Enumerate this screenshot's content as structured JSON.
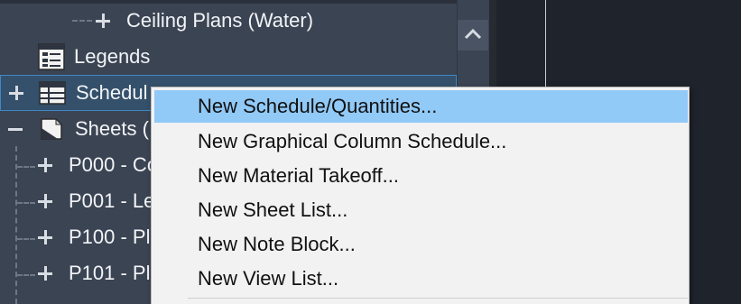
{
  "tree": {
    "items": [
      {
        "label": "Ceiling Plans (Water)",
        "expander": "plus"
      },
      {
        "label": "Legends",
        "icon": "legend-icon"
      },
      {
        "label": "Schedul",
        "expander": "plus",
        "icon": "schedule-icon"
      },
      {
        "label": "Sheets (",
        "expander": "minus",
        "icon": "sheets-icon"
      },
      {
        "label": "P000 - Co",
        "expander": "plus"
      },
      {
        "label": "P001 - Le",
        "expander": "plus"
      },
      {
        "label": "P100 - Pl",
        "expander": "plus"
      },
      {
        "label": "P101 - Pl",
        "expander": "plus"
      }
    ]
  },
  "context_menu": {
    "items": [
      {
        "label": "New Schedule/Quantities...",
        "highlighted": true
      },
      {
        "label": "New Graphical Column Schedule..."
      },
      {
        "label": "New Material Takeoff..."
      },
      {
        "label": "New Sheet List..."
      },
      {
        "label": "New Note Block..."
      },
      {
        "label": "New View List..."
      }
    ]
  },
  "colors": {
    "panel_bg": "#3b4453",
    "view_bg": "#1f232b",
    "menu_bg": "#f2f2f2",
    "menu_highlight": "#91c9f7",
    "selection_border": "#3f88c6"
  }
}
